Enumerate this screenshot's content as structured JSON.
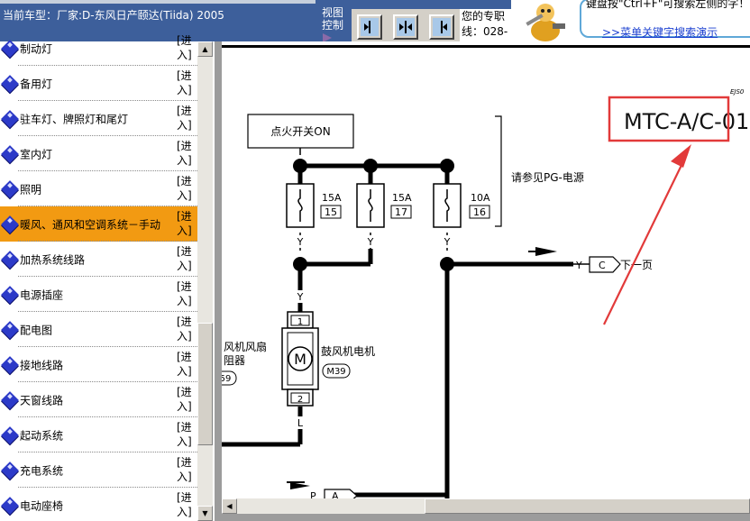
{
  "header": {
    "vehicle": "当前车型：厂家:D-东风日产颐达(Tiida) 2005",
    "view_control": "视图控制",
    "hotline_line1": "您的专职",
    "hotline_line2": "线：028-",
    "tip_text": "键盘按\"Ctrl+F\"可搜索左侧的字！",
    "tip_link": ">>菜单关键字搜索演示"
  },
  "nav": {
    "enter_label": "[进入]",
    "items": [
      {
        "label": "制动灯",
        "active": false
      },
      {
        "label": "备用灯",
        "active": false
      },
      {
        "label": "驻车灯、牌照灯和尾灯",
        "active": false
      },
      {
        "label": "室内灯",
        "active": false
      },
      {
        "label": "照明",
        "active": false
      },
      {
        "label": "暖风、通风和空调系统－手动",
        "active": true
      },
      {
        "label": "加热系统线路",
        "active": false
      },
      {
        "label": "电源插座",
        "active": false
      },
      {
        "label": "配电图",
        "active": false
      },
      {
        "label": "接地线路",
        "active": false
      },
      {
        "label": "天窗线路",
        "active": false
      },
      {
        "label": "起动系统",
        "active": false
      },
      {
        "label": "充电系统",
        "active": false
      },
      {
        "label": "电动座椅",
        "active": false
      }
    ]
  },
  "diagram": {
    "corner_code": "EJS0",
    "diagram_code": "MTC-A/C-01",
    "ignition": "点火开关ON",
    "power_ref": "请参见PG-电源",
    "fuses": [
      {
        "amp": "15A",
        "num": "15"
      },
      {
        "amp": "15A",
        "num": "17"
      },
      {
        "amp": "10A",
        "num": "16"
      }
    ],
    "wire_y": "Y",
    "wire_l": "L",
    "wire_p": "P",
    "connector_c": "C",
    "connector_a": "A",
    "next_page": "下一页",
    "motor_name": "鼓风机电机",
    "motor_symbol": "M",
    "motor_code": "M39",
    "pin1": "1",
    "pin2": "2",
    "left_label_1": "风机风扇",
    "left_label_2": "阻器",
    "left_code": "59"
  },
  "colors": {
    "header_bg": "#3d5f9b",
    "active_item": "#f29a12",
    "highlight_box": "#e23a3a",
    "nav_icon": "#2c3ac8"
  }
}
